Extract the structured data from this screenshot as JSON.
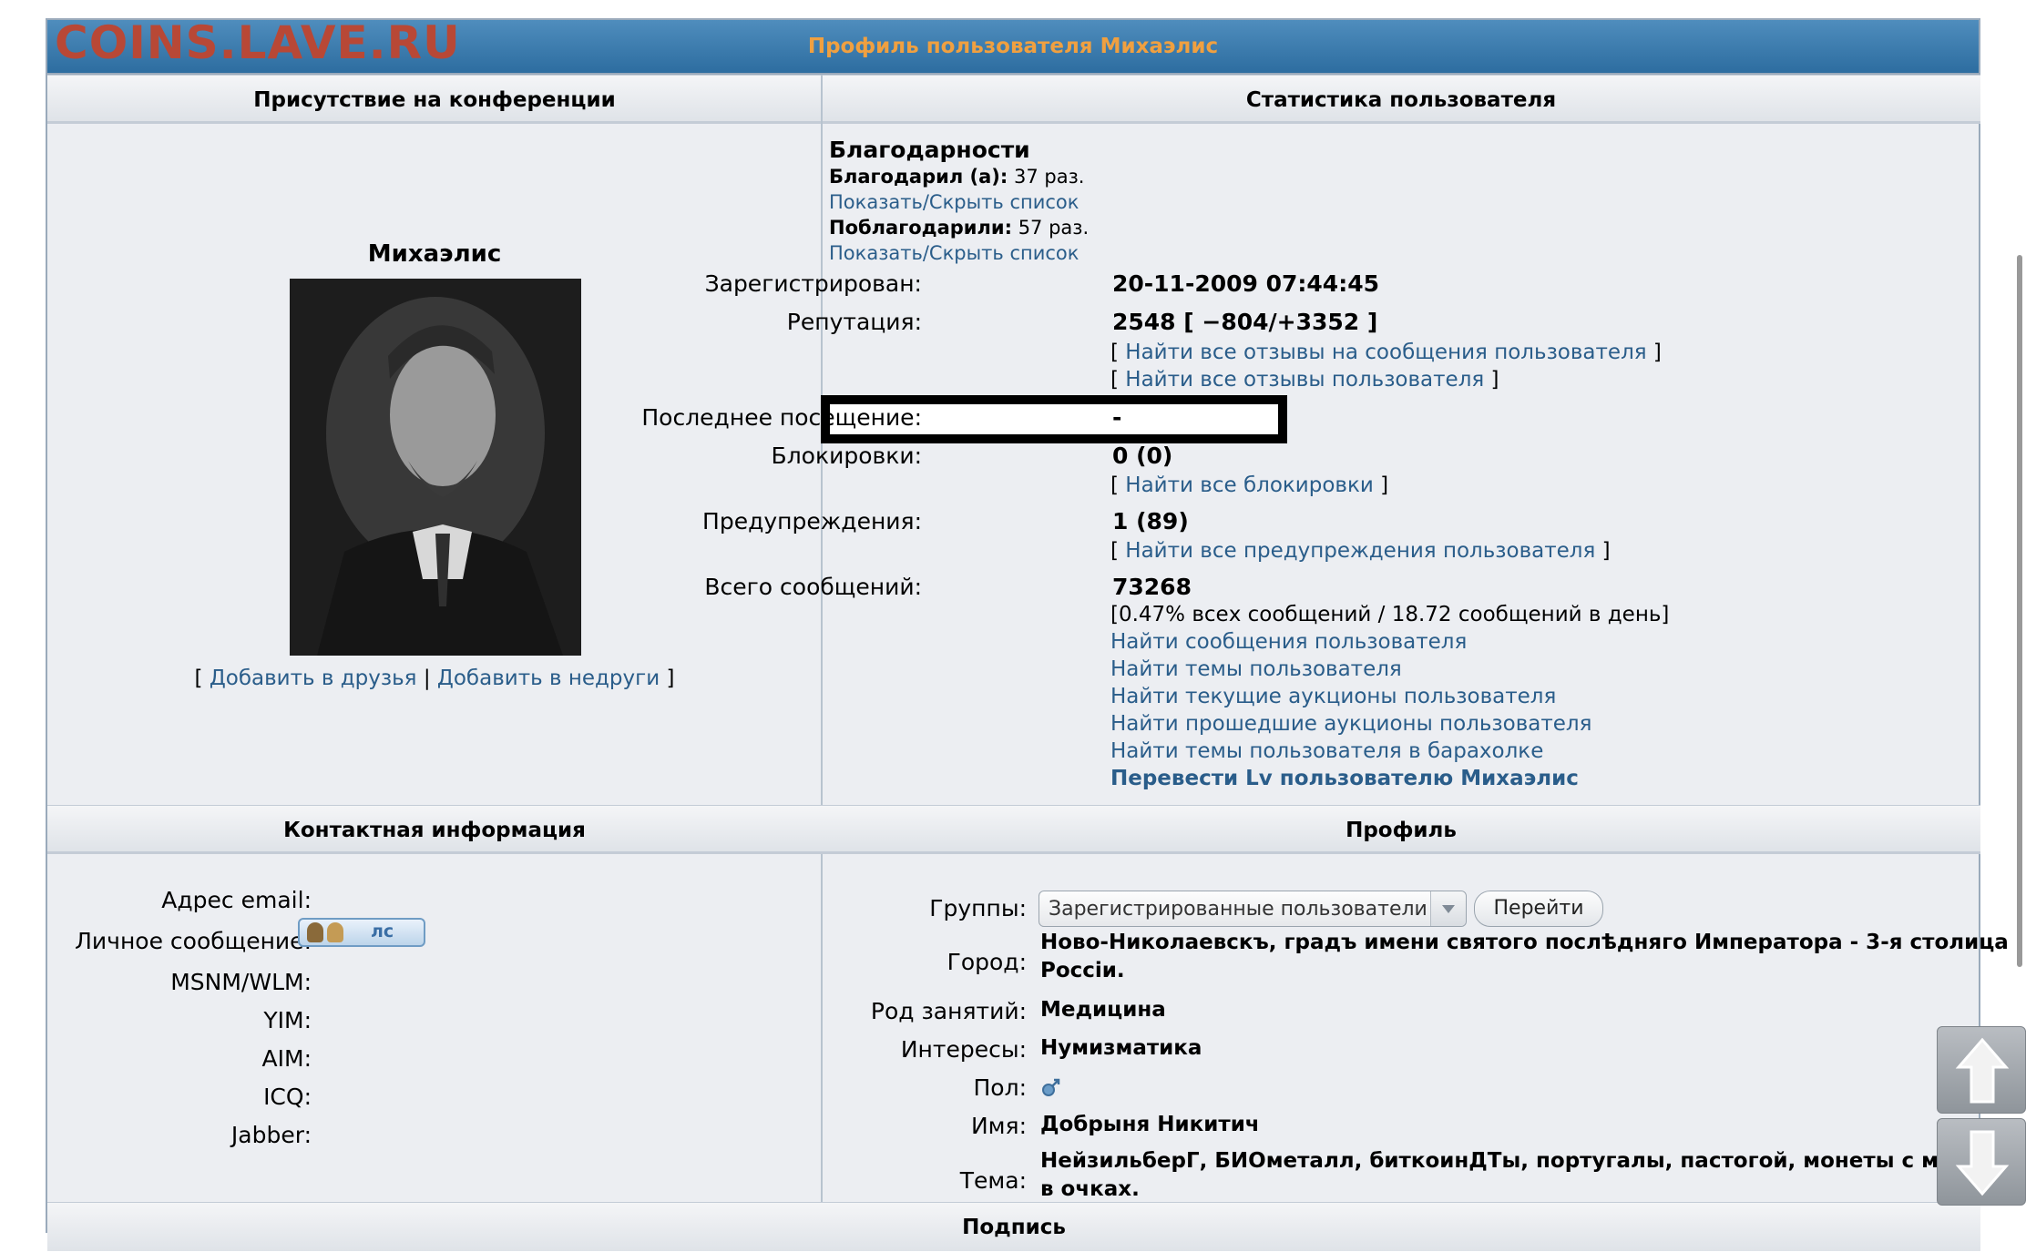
{
  "site_logo": "COINS.LAVE.RU",
  "page_title": "Профиль пользователя Михаэлис",
  "sections": {
    "presence": "Присутствие на конференции",
    "stats": "Статистика пользователя",
    "contact": "Контактная информация",
    "profile": "Профиль",
    "signature": "Подпись"
  },
  "user": {
    "name": "Михаэлис",
    "add_friend": "Добавить в друзья",
    "add_foe": "Добавить в недруги",
    "bracket_open": "[",
    "bracket_close": "]",
    "sep": "|"
  },
  "thanks": {
    "heading": "Благодарности",
    "gave_label": "Благодарил (а):",
    "gave_value": "37 раз.",
    "toggle1": "Показать/Скрыть список",
    "received_label": "Поблагодарили:",
    "received_value": "57 раз.",
    "toggle2": "Показать/Скрыть список"
  },
  "stats": {
    "registered_label": "Зарегистрирован:",
    "registered_value": "20-11-2009 07:44:45",
    "reputation_label": "Репутация:",
    "reputation_value": "2548 [ −804/+3352 ]",
    "rep_link1": "Найти все отзывы на сообщения пользователя",
    "rep_link2": "Найти все отзывы пользователя",
    "last_visit_label": "Последнее посещение:",
    "last_visit_value": "-",
    "bans_label": "Блокировки:",
    "bans_value": "0 (0)",
    "bans_link": "Найти все блокировки",
    "warnings_label": "Предупреждения:",
    "warnings_value": "1 (89)",
    "warnings_link": "Найти все предупреждения пользователя",
    "posts_label": "Всего сообщений:",
    "posts_value": "73268",
    "posts_ratio": "[0.47% всех сообщений / 18.72 сообщений в день]",
    "link_posts": "Найти сообщения пользователя",
    "link_topics": "Найти темы пользователя",
    "link_auctions_current": "Найти текущие аукционы пользователя",
    "link_auctions_past": "Найти прошедшие аукционы пользователя",
    "link_flea": "Найти темы пользователя в барахолке",
    "link_transfer": "Перевести Lv пользователю Михаэлис"
  },
  "contact": {
    "email_label": "Адрес email:",
    "pm_label": "Личное сообщение:",
    "pm_button": "лс",
    "msnm_label": "MSNM/WLM:",
    "yim_label": "YIM:",
    "aim_label": "AIM:",
    "icq_label": "ICQ:",
    "jabber_label": "Jabber:"
  },
  "profile": {
    "groups_label": "Группы:",
    "groups_selected": "Зарегистрированные пользователи",
    "go_button": "Перейти",
    "city_label": "Город:",
    "city_line1": "Ново-Николаевскъ, градъ имени святого послѣдняго Императора - 3-я столица",
    "city_line2": "Россіи.",
    "occupation_label": "Род занятий:",
    "occupation_value": "Медицина",
    "interests_label": "Интересы:",
    "interests_value": "Нумизматика",
    "gender_label": "Пол:",
    "gender_icon": "male-icon",
    "realname_label": "Имя:",
    "realname_value": "Добрыня Никитич",
    "theme_label": "Тема:",
    "theme_line1": "НейзильберГ, БИОметалл, биткоинДТы, португалы, пастогой, монеты с мужЫком",
    "theme_line2": "в очках."
  },
  "colors": {
    "titlebar": "#2d6da0",
    "title_text": "#f0a040",
    "logo": "#b84836",
    "link": "#2a5d8a"
  }
}
